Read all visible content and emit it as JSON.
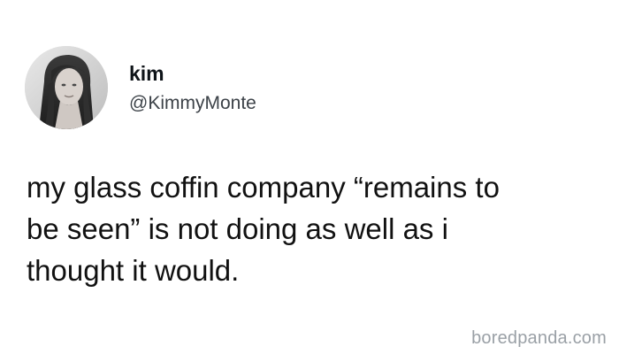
{
  "tweet": {
    "display_name": "kim",
    "handle": "@KimmyMonte",
    "text": "my glass coffin company “remains to\nbe seen” is not doing as well as i\nthought it would.",
    "avatar_icon": "profile-photo"
  },
  "watermark": {
    "text": "boredpanda.com"
  },
  "colors": {
    "background": "#ffffff",
    "text": "#0f1419",
    "handle": "#3c4248",
    "watermark": "#9aa0a6"
  }
}
